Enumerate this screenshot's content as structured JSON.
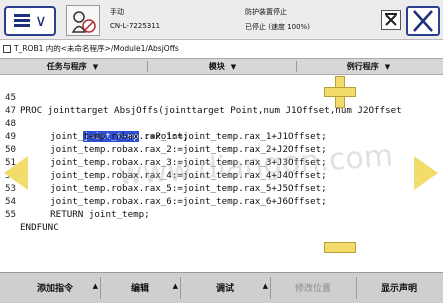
{
  "header": {
    "status_title": "手动",
    "device_id": "CN-L-7225311",
    "safety_title": "防护装置停止",
    "run_status": "已停止 (速度 100%)"
  },
  "breadcrumb": "T_ROB1 内的<未命名程序>/Module1/AbsjOffs",
  "tabs": [
    {
      "label": "任务与程序"
    },
    {
      "label": "模块"
    },
    {
      "label": "例行程序"
    }
  ],
  "code_lines": [
    {
      "num": "45",
      "text": "PROC jointtarget AbsjOffs(jointtarget Point,num J1Offset,num J2Offset"
    },
    {
      "num": "47",
      "pre": "    ",
      "highlight": "joint_temp",
      "text": " :=Point;"
    },
    {
      "num": "48",
      "text": "    joint_temp.robax.rax_1:=joint_temp.rax_1+J1Offset;"
    },
    {
      "num": "49",
      "text": "    joint_temp.robax.rax_2:=joint_temp.rax_2+J2Offset;"
    },
    {
      "num": "50",
      "text": "    joint_temp.robax.rax_3:=joint_temp.rax_3+J3Offset;"
    },
    {
      "num": "51",
      "text": "    joint_temp.robax.rax_4:=joint_temp.rax_4+J4Offset;"
    },
    {
      "num": "52",
      "text": "    joint_temp.robax.rax_5:=joint_temp.rax_5+J5Offset;"
    },
    {
      "num": "53",
      "text": "    joint_temp.robax.rax_6:=joint_temp.rax_6+J6Offset;"
    },
    {
      "num": "54",
      "text": "    RETURN joint_temp;"
    },
    {
      "num": "55",
      "text": "ENDFUNC"
    }
  ],
  "watermark": "www.diangon.com",
  "bottom": {
    "add_instruction": "添加指令",
    "edit": "编辑",
    "debug": "调试",
    "modify_position": "修改位置",
    "show_declaration": "显示声明"
  },
  "colors": {
    "accent": "#2a3f8d",
    "highlight": "#2c4fd4",
    "nav_control": "#f2dc6a"
  }
}
